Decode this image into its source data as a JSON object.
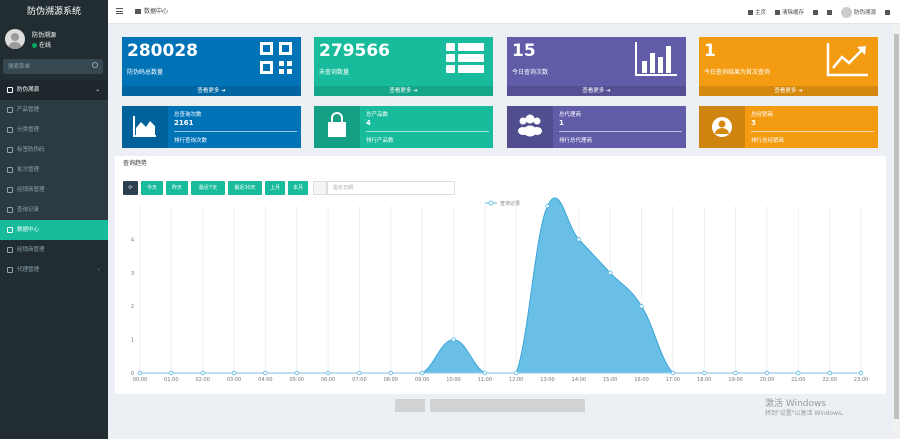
{
  "app": {
    "title": "防伪溯源系统"
  },
  "user": {
    "name": "防伪溯源",
    "status": "在线"
  },
  "sidebar": {
    "search_placeholder": "搜索菜单",
    "items": [
      {
        "label": "防伪溯源"
      },
      {
        "label": "产品管理"
      },
      {
        "label": "分类管理"
      },
      {
        "label": "标签防伪码"
      },
      {
        "label": "批次管理"
      },
      {
        "label": "经销商管理"
      },
      {
        "label": "查询记录"
      },
      {
        "label": "数据中心"
      },
      {
        "label": "经销商管理"
      },
      {
        "label": "代理管理"
      }
    ]
  },
  "topbar": {
    "tab": "数据中心",
    "home": "主页",
    "clear_cache": "清除缓存",
    "username": "防伪溯源"
  },
  "cards": [
    {
      "value": "280028",
      "label": "防伪码总数量",
      "more": "查看更多",
      "color": "#0073b7"
    },
    {
      "value": "279566",
      "label": "未查询数量",
      "more": "查看更多",
      "color": "#18bc9c"
    },
    {
      "value": "15",
      "label": "今日查询次数",
      "more": "查看更多",
      "color": "#605ca8"
    },
    {
      "value": "1",
      "label": "今日查询结果为首次查询",
      "more": "查看更多",
      "color": "#f39c12"
    }
  ],
  "infoboxes": [
    {
      "title": "总查询次数",
      "value": "2161",
      "footer": "排行查询次数",
      "color": "#0073b7"
    },
    {
      "title": "总产品数",
      "value": "4",
      "footer": "排行产品数",
      "color": "#18bc9c"
    },
    {
      "title": "总代理商",
      "value": "1",
      "footer": "排行总代理商",
      "color": "#605ca8"
    },
    {
      "title": "总经销商",
      "value": "3",
      "footer": "排行总经销商",
      "color": "#f39c12"
    }
  ],
  "chart_section": {
    "title": "查询趋势",
    "buttons": [
      "今天",
      "昨天",
      "最近7天",
      "最近30天",
      "上月",
      "本月"
    ],
    "date_placeholder": "指定日期"
  },
  "chart_data": {
    "type": "area",
    "x": [
      "00:00",
      "01:00",
      "02:00",
      "03:00",
      "04:00",
      "05:00",
      "06:00",
      "07:00",
      "08:00",
      "09:00",
      "10:00",
      "11:00",
      "12:00",
      "13:00",
      "14:00",
      "15:00",
      "16:00",
      "17:00",
      "18:00",
      "19:00",
      "20:00",
      "21:00",
      "22:00",
      "23:00"
    ],
    "series": [
      {
        "name": "查询记录",
        "values": [
          0,
          0,
          0,
          0,
          0,
          0,
          0,
          0,
          0,
          0,
          1,
          0,
          0,
          5,
          4,
          3,
          2,
          0,
          0,
          0,
          0,
          0,
          0,
          0
        ]
      }
    ],
    "ylim": [
      0,
      5
    ],
    "yticks": [
      0,
      1,
      2,
      3,
      4
    ],
    "color": "#5ab8e4",
    "legend": "top-center"
  },
  "watermark": {
    "line1": "激活 Windows",
    "line2": "转到\"设置\"以激活 Windows。"
  }
}
